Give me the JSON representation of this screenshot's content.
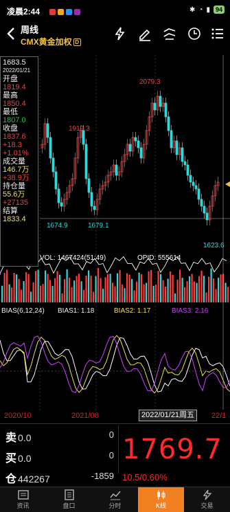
{
  "status": {
    "time": "凌晨2:44",
    "battery": "94"
  },
  "header": {
    "period": "周线",
    "instrument": "CMX黄金加权",
    "badge": "D"
  },
  "info": {
    "top_value": "1683.5",
    "date": "2022/01/21",
    "open_label": "开盘",
    "open": "1819.4",
    "high_label": "最高",
    "high": "1850.4",
    "low_label": "最低",
    "low": "1807.0",
    "close_label": "收盘",
    "close": "1837.6",
    "close_chg": "+18.3",
    "close_pct": "+1.01%",
    "volume_label": "成交量",
    "volume": "146.7万",
    "volume_chg": "+38.9万",
    "oi_label": "持仓量",
    "oi": "55.6万",
    "oi_chg": "+27135",
    "settle_label": "结算",
    "settle": "1833.4"
  },
  "chart_labels": {
    "peak": "2079.3",
    "left_peak": "1919.3",
    "low1": "1674.9",
    "low2": "1679.1",
    "low3": "1623.6"
  },
  "volume_row": {
    "vol": "VOL: 1467424(51:49)",
    "opid": "OPID: 555614"
  },
  "bias_row": {
    "label": "BIAS(6,12,24)",
    "bias1": "BIAS1: 1.18",
    "bias2": "BIAS2: 1.17",
    "bias3": "BIAS3: 2.16"
  },
  "dates": {
    "d1": "2020/10",
    "d2": "2021/06",
    "cursor": "2022/01/21周五",
    "d3": "22/1"
  },
  "quote": {
    "sell_label": "卖",
    "sell_price": "0.0",
    "sell_qty": "0",
    "buy_label": "买",
    "buy_price": "0.0",
    "buy_qty": "0",
    "oi_label": "仓",
    "oi_value": "442267",
    "oi_change": "-1859",
    "last": "1769.7",
    "change": "10.5/0.60%"
  },
  "nav": {
    "items": [
      {
        "label": "资讯"
      },
      {
        "label": "盘口"
      },
      {
        "label": "分时"
      },
      {
        "label": "K线"
      },
      {
        "label": "交易"
      }
    ]
  },
  "colors": {
    "up": "#ff3b3b",
    "down": "#33d6d6",
    "accent": "#f08020",
    "gold": "#f0c040"
  }
}
